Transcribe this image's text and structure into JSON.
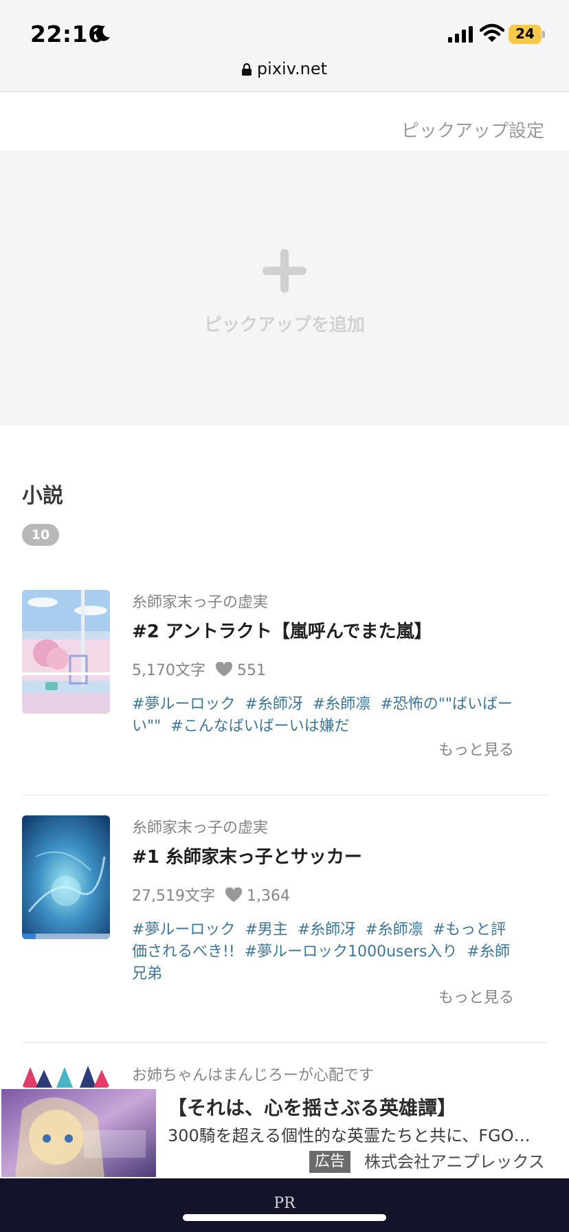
{
  "status_bar": {
    "time": "22:16",
    "battery": "24"
  },
  "browser": {
    "url": "pixiv.net"
  },
  "pickup": {
    "settings_label": "ピックアップ設定",
    "add_label": "ピックアップを追加"
  },
  "section": {
    "title": "小説",
    "count": "10"
  },
  "novels": [
    {
      "series": "糸師家末っ子の虚実",
      "title": "#2 アントラクト【嵐呼んでまた嵐】",
      "chars": "5,170文字",
      "likes": "551",
      "tags": [
        "#夢ルーロック",
        "#糸師冴",
        "#糸師凛",
        "#恐怖の\"\"ばいばーい\"\"",
        "#こんなばいばーいは嫌だ"
      ],
      "more": "もっと見る"
    },
    {
      "series": "糸師家末っ子の虚実",
      "title": "#1 糸師家末っ子とサッカー",
      "chars": "27,519文字",
      "likes": "1,364",
      "tags": [
        "#夢ルーロック",
        "#男主",
        "#糸師冴",
        "#糸師凛",
        "#もっと評価されるべき!!",
        "#夢ルーロック1000users入り",
        "#糸師兄弟"
      ],
      "more": "もっと見る"
    },
    {
      "series": "お姉ちゃんはまんじろーが心配です"
    }
  ],
  "ad": {
    "title": "【それは、心を揺さぶる英雄譚】",
    "description": "300騎を超える個性的な英霊たちと共に、FGO…",
    "label": "広告",
    "company": "株式会社アニプレックス",
    "bar_label": "PR"
  },
  "colors": {
    "tag": "#3d7699",
    "status_bar_bg": "#f5f5f7",
    "pr_bar_bg": "#13132a",
    "battery": "#f7c948"
  }
}
